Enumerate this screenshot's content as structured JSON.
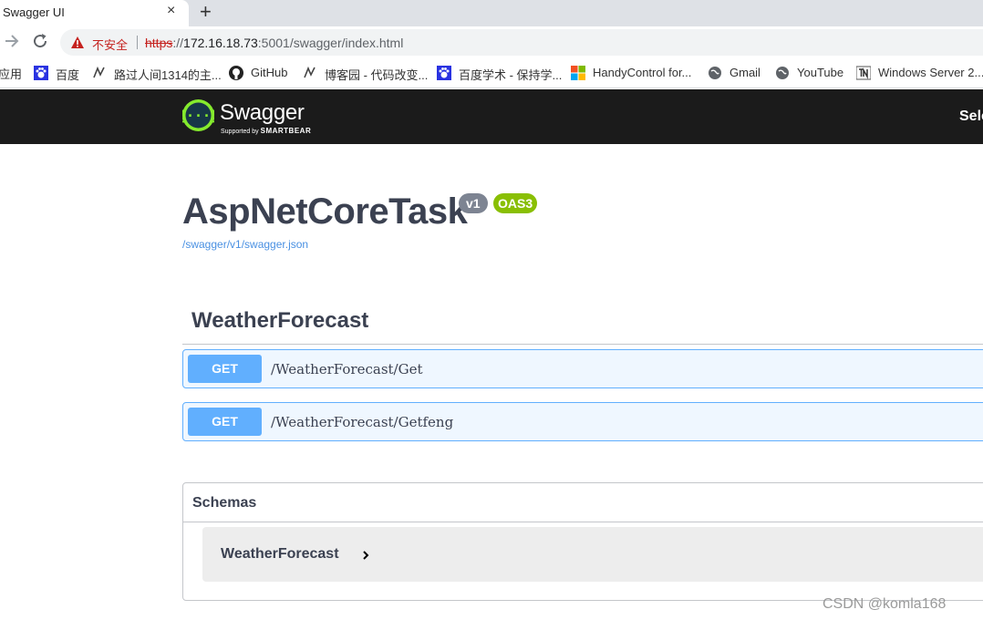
{
  "browser": {
    "tab_title": "Swagger UI",
    "tab_close": "×",
    "new_tab": "+",
    "insecure_label": "不安全",
    "url_scheme": "https",
    "url_sep": "://",
    "url_host": "172.16.18.73",
    "url_rest": ":5001/swagger/index.html"
  },
  "bookmarks": [
    {
      "label": "应用",
      "icon": "apps-icon"
    },
    {
      "label": "百度",
      "icon": "baidu-icon"
    },
    {
      "label": "路过人间1314的主...",
      "icon": "blog-icon"
    },
    {
      "label": "GitHub",
      "icon": "github-icon"
    },
    {
      "label": "博客园 - 代码改变...",
      "icon": "blog-icon"
    },
    {
      "label": "百度学术 - 保持学...",
      "icon": "baidu-icon"
    },
    {
      "label": "HandyControl for...",
      "icon": "windows-icon"
    },
    {
      "label": "Gmail",
      "icon": "globe-icon"
    },
    {
      "label": "YouTube",
      "icon": "globe-icon"
    },
    {
      "label": "Windows Server 2...",
      "icon": "tn-icon"
    }
  ],
  "swagger": {
    "brand": "Swagger",
    "supported_by": "Supported by",
    "smartbear": "SMARTBEAR",
    "select_label": "Sele",
    "colors": {
      "topbar": "#1b1b1b",
      "logo_green": "#85ea2d",
      "get_blue": "#61affe",
      "oas_green": "#89bf04"
    }
  },
  "info": {
    "title": "AspNetCoreTask",
    "version": "v1",
    "oas": "OAS3",
    "spec_link": "/swagger/v1/swagger.json"
  },
  "tag": {
    "name": "WeatherForecast",
    "operations": [
      {
        "method": "GET",
        "path": "/WeatherForecast/Get"
      },
      {
        "method": "GET",
        "path": "/WeatherForecast/Getfeng"
      }
    ]
  },
  "schemas": {
    "title": "Schemas",
    "models": [
      {
        "name": "WeatherForecast"
      }
    ]
  },
  "watermark": "CSDN @komla168"
}
